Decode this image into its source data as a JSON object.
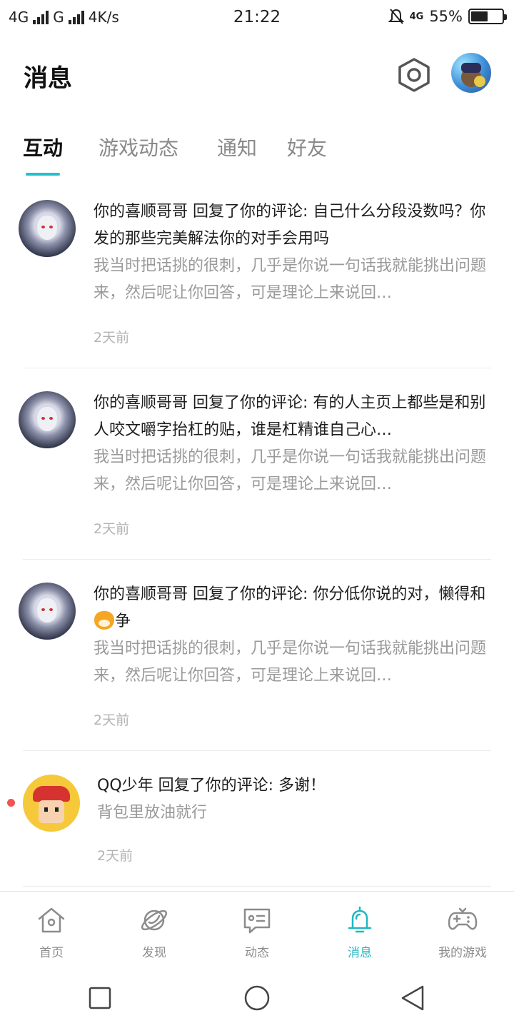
{
  "status_bar": {
    "net1": "4G",
    "net2": "G",
    "speed": "4K/s",
    "time": "21:22",
    "net3": "4G",
    "battery": "55%",
    "battery_level": 0.55
  },
  "header": {
    "title": "消息",
    "settings_icon": "hexagon-settings-icon",
    "avatar_icon": "user-avatar"
  },
  "tabs": [
    {
      "label": "互动",
      "active": true
    },
    {
      "label": "游戏动态",
      "active": false
    },
    {
      "label": "通知",
      "active": false
    },
    {
      "label": "好友",
      "active": false
    }
  ],
  "messages": [
    {
      "headline": "你的喜顺哥哥 回复了你的评论: 自己什么分段没数吗？你发的那些完美解法你的对手会用吗",
      "preview": "我当时把话挑的很刺，几乎是你说一句话我就能挑出问题来，然后呢让你回答，可是理论上来说回…",
      "time": "2天前"
    },
    {
      "headline": "你的喜顺哥哥 回复了你的评论: 有的人主页上都些是和别人咬文嚼字抬杠的贴，谁是杠精谁自己心…",
      "preview": "我当时把话挑的很刺，几乎是你说一句话我就能挑出问题来，然后呢让你回答，可是理论上来说回…",
      "time": "2天前"
    },
    {
      "headline_a": "你的喜顺哥哥 回复了你的评论: 你分低你说的对，懒得和",
      "headline_b": "争",
      "preview": "我当时把话挑的很刺，几乎是你说一句话我就能挑出问题来，然后呢让你回答，可是理论上来说回…",
      "time": "2天前"
    },
    {
      "headline": "QQ少年 回复了你的评论: 多谢！",
      "preview": "背包里放油就行",
      "time": "2天前",
      "unread": true
    }
  ],
  "bottom_nav": [
    {
      "label": "首页",
      "icon": "home-icon",
      "active": false
    },
    {
      "label": "发现",
      "icon": "planet-icon",
      "active": false
    },
    {
      "label": "动态",
      "icon": "feed-icon",
      "active": false
    },
    {
      "label": "消息",
      "icon": "bell-icon",
      "active": true
    },
    {
      "label": "我的游戏",
      "icon": "gamepad-icon",
      "active": false
    }
  ],
  "colors": {
    "accent": "#20c2cc",
    "unread": "#f05454"
  }
}
